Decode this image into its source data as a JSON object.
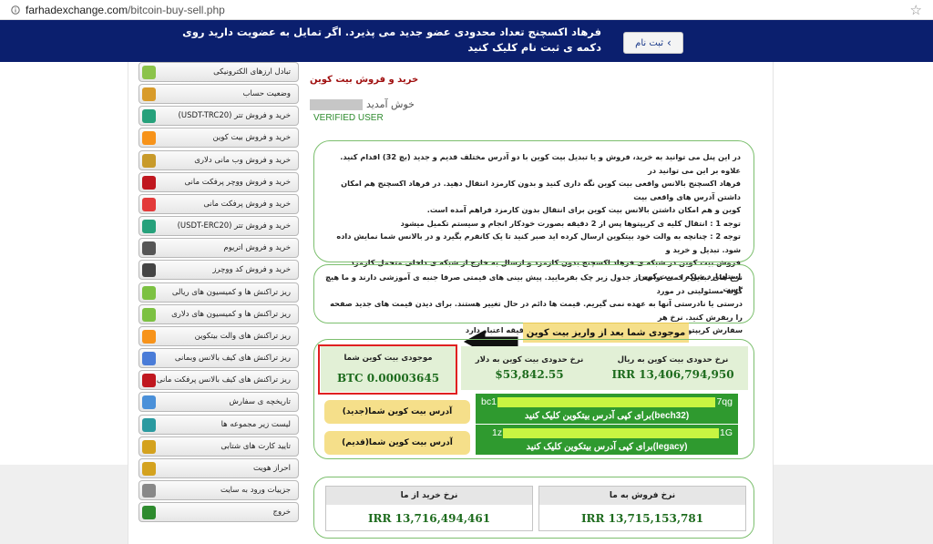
{
  "browser": {
    "url_domain": "farhadexchange.com",
    "url_path": "/bitcoin-buy-sell.php"
  },
  "banner": {
    "text": "فرهاد اکسچنج تعداد محدودی عضو جدید می پذیرد. اگر تمایل به عضویت دارید روی دکمه ی ثبت نام کلیک کنید",
    "button_label": "ثبت نام"
  },
  "sidebar": {
    "items": [
      {
        "label": "تبادل ارزهای الکترونیکی",
        "icon": "exchange-icon",
        "color": "#8bc34a"
      },
      {
        "label": "وضعیت حساب",
        "icon": "home-icon",
        "color": "#d89b2a"
      },
      {
        "label": "خرید و فروش تتر (USDT-TRC20)",
        "icon": "tether-icon",
        "color": "#26a17b"
      },
      {
        "label": "خرید و فروش بیت کوین",
        "icon": "bitcoin-icon",
        "color": "#f7931a"
      },
      {
        "label": "خرید و فروش وب مانی دلاری",
        "icon": "webmoney-icon",
        "color": "#c89a2a"
      },
      {
        "label": "خرید و فروش ووچر پرفکت مانی",
        "icon": "voucher-icon",
        "color": "#c0171f"
      },
      {
        "label": "خرید و فروش پرفکت مانی",
        "icon": "perfectmoney-icon",
        "color": "#e33a3a"
      },
      {
        "label": "خرید و فروش تتر (USDT-ERC20)",
        "icon": "tether-erc-icon",
        "color": "#26a17b"
      },
      {
        "label": "خرید و فروش اتریوم",
        "icon": "ethereum-icon",
        "color": "#555555"
      },
      {
        "label": "خرید و فروش کد ووچرز",
        "icon": "code-voucher-icon",
        "color": "#444444"
      },
      {
        "label": "ریز تراکنش ها و کمیسیون های ریالی",
        "icon": "rial-icon",
        "color": "#7cc142"
      },
      {
        "label": "ریز تراکنش ها و کمیسیون های دلاری",
        "icon": "dollar-icon",
        "color": "#7cc142"
      },
      {
        "label": "ریز تراکنش های والت بیتکوین",
        "icon": "btc-wallet-icon",
        "color": "#f7931a"
      },
      {
        "label": "ریز تراکنش های کیف بالانس وبمانی",
        "icon": "wm-wallet-icon",
        "color": "#4a7cd8"
      },
      {
        "label": "ریز تراکنش های کیف بالانس پرفکت مانی",
        "icon": "pm-wallet-icon",
        "color": "#c0171f"
      },
      {
        "label": "تاریخچه ی سفارش",
        "icon": "history-icon",
        "color": "#4a90d9"
      },
      {
        "label": "لیست زیر مجموعه ها",
        "icon": "referral-icon",
        "color": "#2a9aa0"
      },
      {
        "label": "تایید کارت های شتابی",
        "icon": "key-icon",
        "color": "#d4a21e"
      },
      {
        "label": "احراز هویت",
        "icon": "verify-key-icon",
        "color": "#d4a21e"
      },
      {
        "label": "جزییات ورود به سایت",
        "icon": "login-details-icon",
        "color": "#888888"
      },
      {
        "label": "خروج",
        "icon": "logout-icon",
        "color": "#2e8b2e"
      }
    ]
  },
  "main": {
    "title": "خرید و فروش بیت کوین",
    "welcome": "خوش آمدید",
    "verified": "VERIFIED USER",
    "info_lines": [
      "در این پنل می توانید به خرید، فروش و یا تبدیل بیت کوین با دو آدرس مختلف قدیم و جدید (بچ 32) اقدام کنید. علاوه بر این می توانید در",
      "فرهاد اکسچنج بالانس واقعی بیت کوین نگه داری کنید و بدون کارمزد انتقال دهید. در فرهاد اکسچنج هم امکان داشتن آدرس های واقعی بیت",
      "کوین و هم امکان داشتن بالانس بیت کوین برای انتقال بدون کارمزد فراهم آمده است.",
      "توجه 1 : انتقال کلیه ی کریپتوها پس از 2 دقیقه بصورت خودکار انجام و سیستم تکمیل میشود",
      "توجه 2 : چنانچه به والت خود بیتکوین ارسال کرده اید صبر کنید تا یک کانفرم بگیرد و در بالانس شما نمایش داده شود. تبدیل و خرید و",
      "فروش بیت کوین در شبکه ی فرهاد اکسچنج بدون کارمزد و ارسال به خارج از شبکه ی داخلی متحمل کارمزد استاندارد شبکه ی بیت کوین",
      "است"
    ],
    "note_lines": [
      "نرخ های تبدیل را می توانید از جدول زیر چک بفرمایید. پیش بینی های قیمتی صرفا جنبه ی آموزشی دارند و ما هیچ گونه مسئولیتی در مورد",
      "درستی یا نادرستی آنها به عهده نمی گیریم. قیمت ها دائم در حال تغییر هستند. برای دیدن قیمت های جدید صفحه را ریفرش کنید. نرخ هر",
      "سفارش کریپتو لحظه ای و سفارش غیر کریپتو فقط تا 15 دقیقه اعتبار دارد"
    ],
    "balance_section_title": "موجودی شما بعد از واریز بیت کوین",
    "cells": {
      "rial_rate_label": "نرخ حدودی بیت کوین به ریال",
      "rial_rate_value": "IRR 13,406,794,950",
      "usd_rate_label": "نرخ حدودی بیت کوین به دلار",
      "usd_rate_value": "$53,842.55",
      "balance_label": "موجودی بیت کوین شما",
      "balance_value": "BTC 0.00003645"
    },
    "addresses": {
      "new_label": "آدرس بیت کوین شما(جدید)",
      "new_prefix": "bc1",
      "new_suffix": "7qg",
      "new_note": "(bech32)برای کپی آدرس بیتکوین کلیک کنید",
      "old_label": "آدرس بیت کوین شما(قدیم)",
      "old_prefix": "1z",
      "old_suffix": "1G",
      "old_note": "(legacy)برای کپی آدرس بیتکوین کلیک کنید"
    },
    "rates": {
      "buy_label": "نرخ خرید از ما",
      "buy_value": "IRR 13,716,494,461",
      "sell_label": "نرخ فروش به ما",
      "sell_value": "IRR 13,715,153,781"
    }
  },
  "colors": {
    "banner_bg": "#0b1f6e",
    "title_red": "#a01010",
    "verified_green": "#2e8b2e",
    "address_green": "#2f9a2f",
    "highlight_frame": "#e02020",
    "section_yellow": "#f5df8a"
  }
}
